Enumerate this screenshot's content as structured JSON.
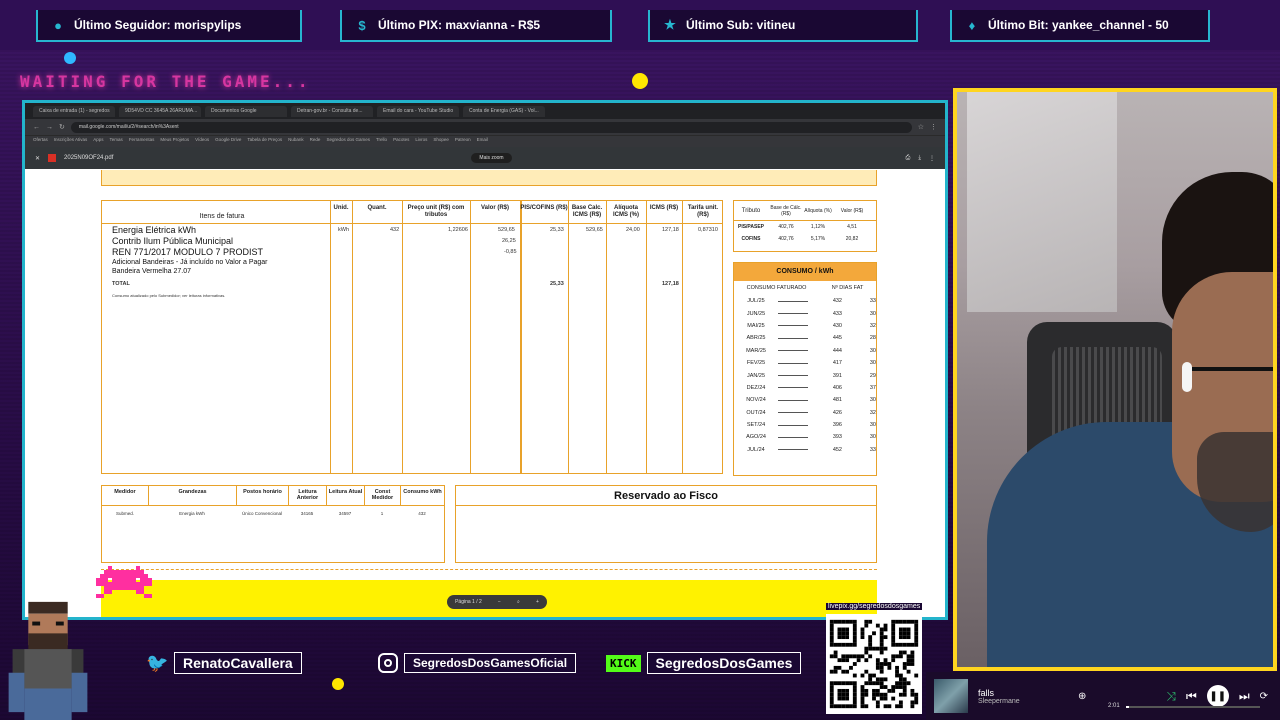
{
  "alerts": {
    "follower": "Último Seguidor: morispylips",
    "pix": "Último PIX: maxvianna - R$5",
    "sub": "Último Sub: vitineu",
    "bit": "Último Bit: yankee_channel - 50"
  },
  "waiting_text": "WAITING FOR THE GAME...",
  "browser": {
    "tabs": [
      "Caixa de entrada (1) - segredos",
      "9D54VD CC 3645A 26ARUMA...",
      "Documentos Google",
      "Detran-gov.br - Consulta de...",
      "Email do cara - YouTube Studio",
      "Conta de Energia (GAS) - Vol..."
    ],
    "address": "mail.google.com/mail/u/2/#search/in%3Asent",
    "bookmarks": [
      "Ofertas",
      "Inscrições Ativas",
      "Apps",
      "Temas",
      "Ferramentas",
      "Meus Projetos",
      "Vídeos",
      "Google Drive",
      "Tabela de Preços",
      "Nubank",
      "Rede",
      "Segredos dos Games",
      "Trello",
      "Pacotes",
      "Livros",
      "Shopee",
      "Patreon",
      "Email"
    ],
    "pdf_filename": "2025N09OF24.pdf",
    "zoom_label": "Mais zoom"
  },
  "invoice": {
    "headers": [
      "Itens de fatura",
      "Unid.",
      "Quant.",
      "Preço unit (R$) com tributos",
      "Valor (R$)",
      "PIS/COFINS (R$)",
      "Base Calc. ICMS (R$)",
      "Alíquota ICMS (%)",
      "ICMS (R$)",
      "Tarifa unit. (R$)"
    ],
    "items": [
      {
        "name": "Energia Elétrica kWh",
        "unit": "kWh",
        "qty": "432",
        "price": "1,22606",
        "value": "529,65",
        "pis": "25,33",
        "base": "529,65",
        "aliq": "24,00",
        "icms": "127,18",
        "tarifa": "0,87310"
      },
      {
        "name": "Contrib Ilum Pública Municipal",
        "value": "26,25"
      },
      {
        "name": "REN 771/2017 MODULO 7 PRODIST",
        "value": "-0,85"
      }
    ],
    "notes": [
      "Adicional Bandeiras - Já incluído no Valor a Pagar",
      "Bandeira Vermelha 27.07"
    ],
    "total_label": "TOTAL",
    "total_pis": "25,33",
    "total_icms": "127,18",
    "footnote": "Consumo atualizado pelo Submedidor; ver leituras informativas.",
    "tribute_headers": [
      "Tributo",
      "Base de Cálc. (R$)",
      "Alíquota (%)",
      "Valor (R$)"
    ],
    "tributes": [
      {
        "name": "PIS/PASEP",
        "base": "402,76",
        "aliq": "1,12%",
        "valor": "4,51"
      },
      {
        "name": "COFINS",
        "base": "402,76",
        "aliq": "5,17%",
        "valor": "20,82"
      }
    ],
    "consumo_title": "CONSUMO / kWh",
    "consumo_headers": [
      "CONSUMO FATURADO",
      "Nº DIAS FAT"
    ],
    "consumo": [
      {
        "month": "JUL/25",
        "kwh": "432",
        "days": "33"
      },
      {
        "month": "JUN/25",
        "kwh": "433",
        "days": "30"
      },
      {
        "month": "MAI/25",
        "kwh": "430",
        "days": "32"
      },
      {
        "month": "ABR/25",
        "kwh": "445",
        "days": "28"
      },
      {
        "month": "MAR/25",
        "kwh": "444",
        "days": "30"
      },
      {
        "month": "FEV/25",
        "kwh": "417",
        "days": "30"
      },
      {
        "month": "JAN/25",
        "kwh": "391",
        "days": "29"
      },
      {
        "month": "DEZ/24",
        "kwh": "406",
        "days": "37"
      },
      {
        "month": "NOV/24",
        "kwh": "481",
        "days": "30"
      },
      {
        "month": "OUT/24",
        "kwh": "426",
        "days": "32"
      },
      {
        "month": "SET/24",
        "kwh": "396",
        "days": "30"
      },
      {
        "month": "AGO/24",
        "kwh": "393",
        "days": "30"
      },
      {
        "month": "JUL/24",
        "kwh": "452",
        "days": "33"
      }
    ],
    "meter_headers": [
      "Medidor",
      "Grandezas",
      "Postos horário",
      "Leitura Anterior",
      "Leitura Atual",
      "Const Medidor",
      "Consumo kWh"
    ],
    "meter_row": [
      "Submed.",
      "Energia kWh",
      "Único Convencional",
      "34165",
      "34597",
      "1",
      "432"
    ],
    "fisco_title": "Reservado ao Fisco",
    "page_ctrl": "Página 1 / 2"
  },
  "socials": {
    "twitter": "RenatoCavallera",
    "instagram": "SegredosDosGamesOficial",
    "kick_badge": "KICK",
    "kick": "SegredosDosGames"
  },
  "qr_url": "livepix.gg/segredosdosgames",
  "player": {
    "track": "falls",
    "artist": "Sleepermane",
    "time": "2:01",
    "progress": 0.02
  },
  "colors": {
    "accent_cyan": "#27b6cf",
    "frame_yellow": "#ffd51f",
    "invoice_orange": "#e8a22a",
    "bg_purple": "#2a0f44"
  }
}
